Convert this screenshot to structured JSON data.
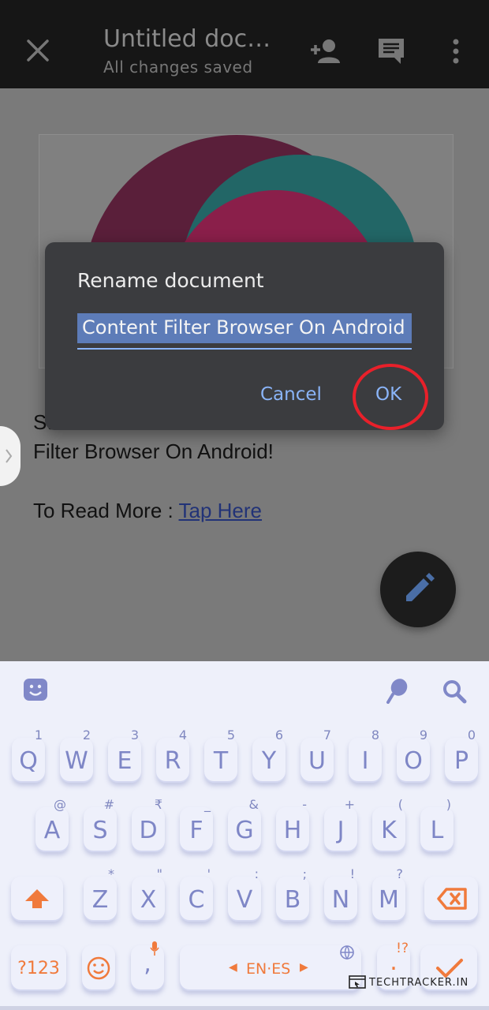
{
  "topbar": {
    "title": "Untitled doc…",
    "subtitle": "All changes saved",
    "icons": [
      "close-icon",
      "add-person-icon",
      "comment-icon",
      "more-vert-icon"
    ]
  },
  "document": {
    "line1": "St",
    "line2": "Filter Browser On Android!",
    "read_more_label": "To Read More : ",
    "read_more_link": "Tap Here"
  },
  "dialog": {
    "title": "Rename document",
    "input_value": "Content Filter Browser On Android",
    "cancel_label": "Cancel",
    "ok_label": "OK"
  },
  "keyboard": {
    "row1": [
      {
        "key": "Q",
        "alt": "1"
      },
      {
        "key": "W",
        "alt": "2"
      },
      {
        "key": "E",
        "alt": "3"
      },
      {
        "key": "R",
        "alt": "4"
      },
      {
        "key": "T",
        "alt": "5"
      },
      {
        "key": "Y",
        "alt": "6"
      },
      {
        "key": "U",
        "alt": "7"
      },
      {
        "key": "I",
        "alt": "8"
      },
      {
        "key": "O",
        "alt": "9"
      },
      {
        "key": "P",
        "alt": "0"
      }
    ],
    "row2": [
      {
        "key": "A",
        "alt": "@"
      },
      {
        "key": "S",
        "alt": "#"
      },
      {
        "key": "D",
        "alt": "₹"
      },
      {
        "key": "F",
        "alt": "_"
      },
      {
        "key": "G",
        "alt": "&"
      },
      {
        "key": "H",
        "alt": "-"
      },
      {
        "key": "J",
        "alt": "+"
      },
      {
        "key": "K",
        "alt": "("
      },
      {
        "key": "L",
        "alt": ")"
      }
    ],
    "row3": [
      {
        "key": "Z",
        "alt": "*"
      },
      {
        "key": "X",
        "alt": "\""
      },
      {
        "key": "C",
        "alt": "'"
      },
      {
        "key": "V",
        "alt": ":"
      },
      {
        "key": "B",
        "alt": ";"
      },
      {
        "key": "N",
        "alt": "!"
      },
      {
        "key": "M",
        "alt": "?"
      }
    ],
    "symbols_label": "?123",
    "comma_key": ",",
    "space_label": "EN·ES",
    "period_key": ".",
    "period_alt": "!?",
    "accent_color": "#f07a3c",
    "key_text_color": "#7e86c6"
  },
  "watermark": {
    "text": "TECHTRACKER.IN"
  }
}
